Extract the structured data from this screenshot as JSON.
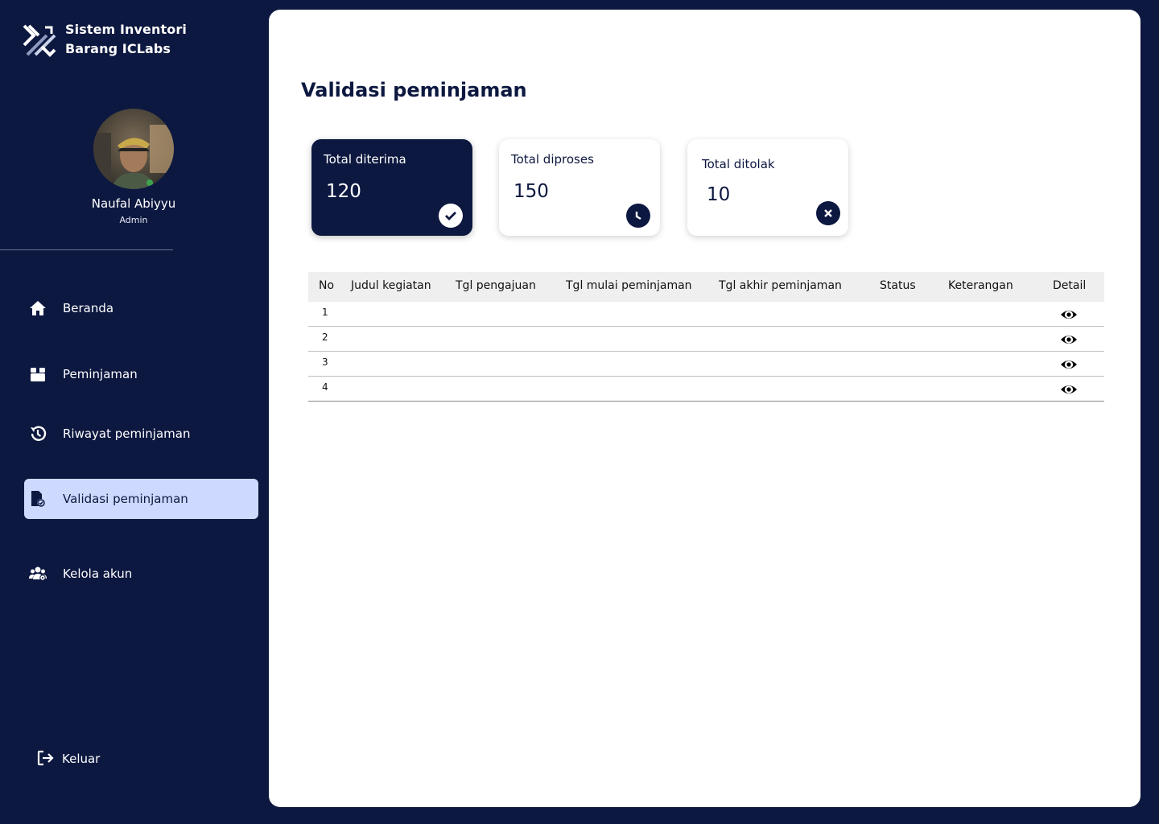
{
  "app": {
    "title": "Sistem Inventori\nBarang ICLabs"
  },
  "user": {
    "name": "Naufal Abiyyu",
    "role": "Admin"
  },
  "sidebar": {
    "items": [
      {
        "label": "Beranda",
        "icon": "home-icon"
      },
      {
        "label": "Peminjaman",
        "icon": "box-icon"
      },
      {
        "label": "Riwayat peminjaman",
        "icon": "history-icon"
      },
      {
        "label": "Validasi peminjaman",
        "icon": "file-check-icon",
        "active": true
      },
      {
        "label": "Kelola akun",
        "icon": "users-icon"
      }
    ],
    "logout_label": "Keluar"
  },
  "page": {
    "title": "Validasi peminjaman"
  },
  "stats": [
    {
      "label": "Total diterima",
      "value": "120",
      "icon": "check-icon"
    },
    {
      "label": "Total diproses",
      "value": "150",
      "icon": "clock-icon"
    },
    {
      "label": "Total ditolak",
      "value": "10",
      "icon": "x-icon"
    }
  ],
  "table": {
    "headers": [
      "No",
      "Judul kegiatan",
      "Tgl pengajuan",
      "Tgl mulai peminjaman",
      "Tgl akhir peminjaman",
      "Status",
      "Keterangan",
      "Detail"
    ],
    "rows": [
      {
        "no": "1"
      },
      {
        "no": "2"
      },
      {
        "no": "3"
      },
      {
        "no": "4"
      }
    ]
  },
  "colors": {
    "navy": "#0d1840",
    "active_bg": "#cdd9ff",
    "header_bg": "#efefef"
  }
}
